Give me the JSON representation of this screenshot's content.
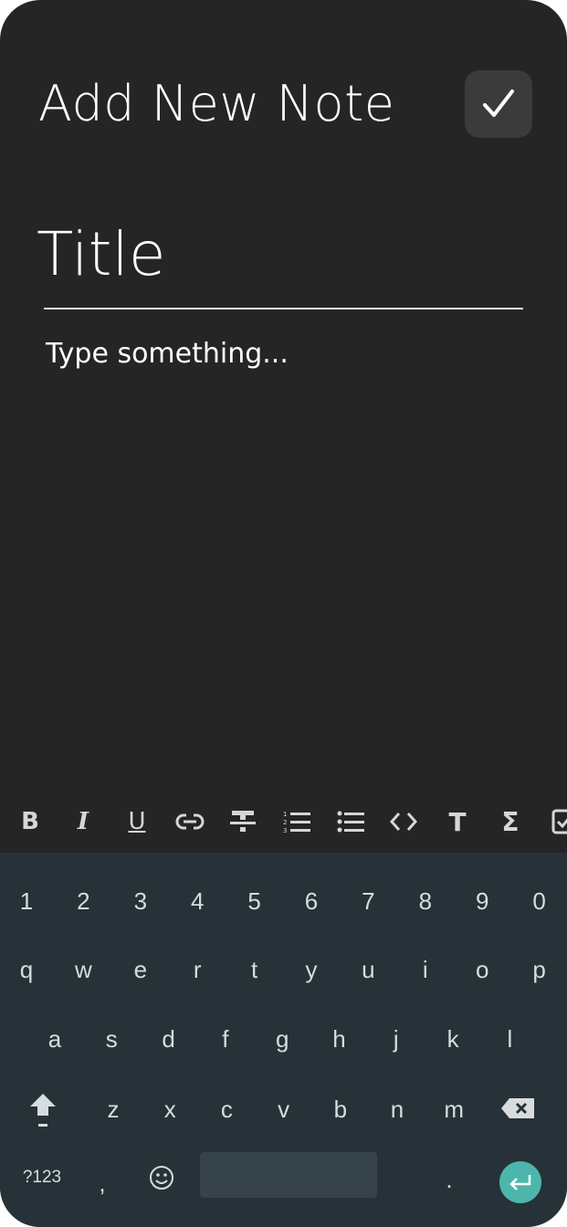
{
  "header": {
    "title": "Add New Note",
    "save_icon": "check-icon"
  },
  "editor": {
    "title_placeholder": "Title",
    "body_placeholder": "Type something..."
  },
  "toolbar": {
    "items": [
      "bold",
      "italic",
      "underline",
      "link",
      "strikethrough",
      "numbered-list",
      "bulleted-list",
      "code",
      "text-size",
      "sigma",
      "checkbox"
    ]
  },
  "keyboard": {
    "row1": [
      "1",
      "2",
      "3",
      "4",
      "5",
      "6",
      "7",
      "8",
      "9",
      "0"
    ],
    "row2": [
      "q",
      "w",
      "e",
      "r",
      "t",
      "y",
      "u",
      "i",
      "o",
      "p"
    ],
    "row3": [
      "a",
      "s",
      "d",
      "f",
      "g",
      "h",
      "j",
      "k",
      "l"
    ],
    "row4": [
      "z",
      "x",
      "c",
      "v",
      "b",
      "n",
      "m"
    ],
    "symbols_label": "?123",
    "comma": ",",
    "period": ".",
    "enter_color": "#4db6ac"
  }
}
